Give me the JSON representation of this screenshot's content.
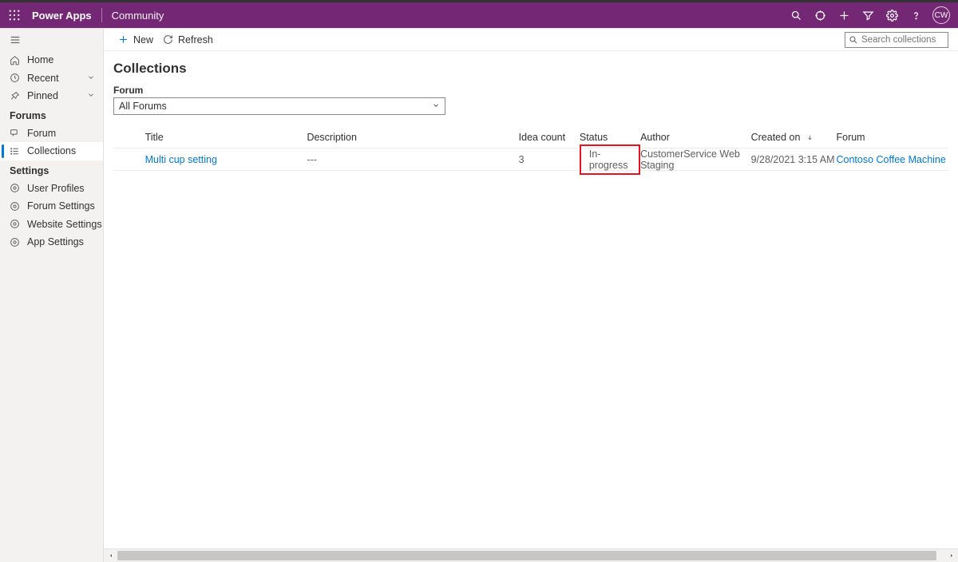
{
  "header": {
    "app_name": "Power Apps",
    "sub_name": "Community",
    "avatar_initials": "CW"
  },
  "sidebar": {
    "home_label": "Home",
    "recent_label": "Recent",
    "pinned_label": "Pinned",
    "forums_heading": "Forums",
    "forum_label": "Forum",
    "collections_label": "Collections",
    "settings_heading": "Settings",
    "user_profiles_label": "User Profiles",
    "forum_settings_label": "Forum Settings",
    "website_settings_label": "Website Settings",
    "app_settings_label": "App Settings"
  },
  "cmdbar": {
    "new_label": "New",
    "refresh_label": "Refresh",
    "search_placeholder": "Search collections"
  },
  "page": {
    "title": "Collections",
    "forum_label": "Forum",
    "forum_selected": "All Forums"
  },
  "columns": {
    "title": "Title",
    "description": "Description",
    "idea_count": "Idea count",
    "status": "Status",
    "author": "Author",
    "created_on": "Created on",
    "forum": "Forum"
  },
  "rows": [
    {
      "title": "Multi cup setting",
      "description": "---",
      "idea_count": "3",
      "status": "In-progress",
      "author": "CustomerService Web Staging",
      "created_on": "9/28/2021 3:15 AM",
      "forum": "Contoso Coffee Machine"
    }
  ]
}
